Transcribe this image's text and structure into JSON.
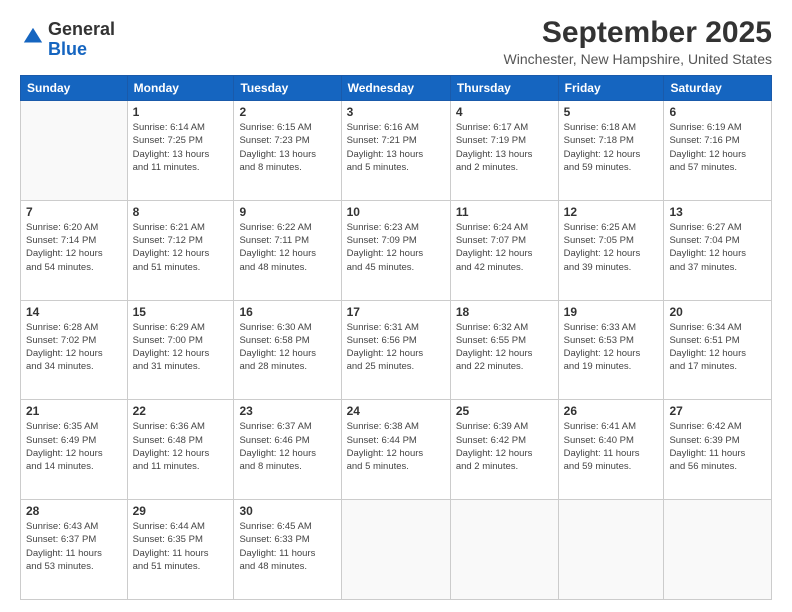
{
  "logo": {
    "general": "General",
    "blue": "Blue"
  },
  "header": {
    "month_title": "September 2025",
    "location": "Winchester, New Hampshire, United States"
  },
  "weekdays": [
    "Sunday",
    "Monday",
    "Tuesday",
    "Wednesday",
    "Thursday",
    "Friday",
    "Saturday"
  ],
  "weeks": [
    [
      {
        "day": "",
        "info": ""
      },
      {
        "day": "1",
        "info": "Sunrise: 6:14 AM\nSunset: 7:25 PM\nDaylight: 13 hours\nand 11 minutes."
      },
      {
        "day": "2",
        "info": "Sunrise: 6:15 AM\nSunset: 7:23 PM\nDaylight: 13 hours\nand 8 minutes."
      },
      {
        "day": "3",
        "info": "Sunrise: 6:16 AM\nSunset: 7:21 PM\nDaylight: 13 hours\nand 5 minutes."
      },
      {
        "day": "4",
        "info": "Sunrise: 6:17 AM\nSunset: 7:19 PM\nDaylight: 13 hours\nand 2 minutes."
      },
      {
        "day": "5",
        "info": "Sunrise: 6:18 AM\nSunset: 7:18 PM\nDaylight: 12 hours\nand 59 minutes."
      },
      {
        "day": "6",
        "info": "Sunrise: 6:19 AM\nSunset: 7:16 PM\nDaylight: 12 hours\nand 57 minutes."
      }
    ],
    [
      {
        "day": "7",
        "info": "Sunrise: 6:20 AM\nSunset: 7:14 PM\nDaylight: 12 hours\nand 54 minutes."
      },
      {
        "day": "8",
        "info": "Sunrise: 6:21 AM\nSunset: 7:12 PM\nDaylight: 12 hours\nand 51 minutes."
      },
      {
        "day": "9",
        "info": "Sunrise: 6:22 AM\nSunset: 7:11 PM\nDaylight: 12 hours\nand 48 minutes."
      },
      {
        "day": "10",
        "info": "Sunrise: 6:23 AM\nSunset: 7:09 PM\nDaylight: 12 hours\nand 45 minutes."
      },
      {
        "day": "11",
        "info": "Sunrise: 6:24 AM\nSunset: 7:07 PM\nDaylight: 12 hours\nand 42 minutes."
      },
      {
        "day": "12",
        "info": "Sunrise: 6:25 AM\nSunset: 7:05 PM\nDaylight: 12 hours\nand 39 minutes."
      },
      {
        "day": "13",
        "info": "Sunrise: 6:27 AM\nSunset: 7:04 PM\nDaylight: 12 hours\nand 37 minutes."
      }
    ],
    [
      {
        "day": "14",
        "info": "Sunrise: 6:28 AM\nSunset: 7:02 PM\nDaylight: 12 hours\nand 34 minutes."
      },
      {
        "day": "15",
        "info": "Sunrise: 6:29 AM\nSunset: 7:00 PM\nDaylight: 12 hours\nand 31 minutes."
      },
      {
        "day": "16",
        "info": "Sunrise: 6:30 AM\nSunset: 6:58 PM\nDaylight: 12 hours\nand 28 minutes."
      },
      {
        "day": "17",
        "info": "Sunrise: 6:31 AM\nSunset: 6:56 PM\nDaylight: 12 hours\nand 25 minutes."
      },
      {
        "day": "18",
        "info": "Sunrise: 6:32 AM\nSunset: 6:55 PM\nDaylight: 12 hours\nand 22 minutes."
      },
      {
        "day": "19",
        "info": "Sunrise: 6:33 AM\nSunset: 6:53 PM\nDaylight: 12 hours\nand 19 minutes."
      },
      {
        "day": "20",
        "info": "Sunrise: 6:34 AM\nSunset: 6:51 PM\nDaylight: 12 hours\nand 17 minutes."
      }
    ],
    [
      {
        "day": "21",
        "info": "Sunrise: 6:35 AM\nSunset: 6:49 PM\nDaylight: 12 hours\nand 14 minutes."
      },
      {
        "day": "22",
        "info": "Sunrise: 6:36 AM\nSunset: 6:48 PM\nDaylight: 12 hours\nand 11 minutes."
      },
      {
        "day": "23",
        "info": "Sunrise: 6:37 AM\nSunset: 6:46 PM\nDaylight: 12 hours\nand 8 minutes."
      },
      {
        "day": "24",
        "info": "Sunrise: 6:38 AM\nSunset: 6:44 PM\nDaylight: 12 hours\nand 5 minutes."
      },
      {
        "day": "25",
        "info": "Sunrise: 6:39 AM\nSunset: 6:42 PM\nDaylight: 12 hours\nand 2 minutes."
      },
      {
        "day": "26",
        "info": "Sunrise: 6:41 AM\nSunset: 6:40 PM\nDaylight: 11 hours\nand 59 minutes."
      },
      {
        "day": "27",
        "info": "Sunrise: 6:42 AM\nSunset: 6:39 PM\nDaylight: 11 hours\nand 56 minutes."
      }
    ],
    [
      {
        "day": "28",
        "info": "Sunrise: 6:43 AM\nSunset: 6:37 PM\nDaylight: 11 hours\nand 53 minutes."
      },
      {
        "day": "29",
        "info": "Sunrise: 6:44 AM\nSunset: 6:35 PM\nDaylight: 11 hours\nand 51 minutes."
      },
      {
        "day": "30",
        "info": "Sunrise: 6:45 AM\nSunset: 6:33 PM\nDaylight: 11 hours\nand 48 minutes."
      },
      {
        "day": "",
        "info": ""
      },
      {
        "day": "",
        "info": ""
      },
      {
        "day": "",
        "info": ""
      },
      {
        "day": "",
        "info": ""
      }
    ]
  ]
}
